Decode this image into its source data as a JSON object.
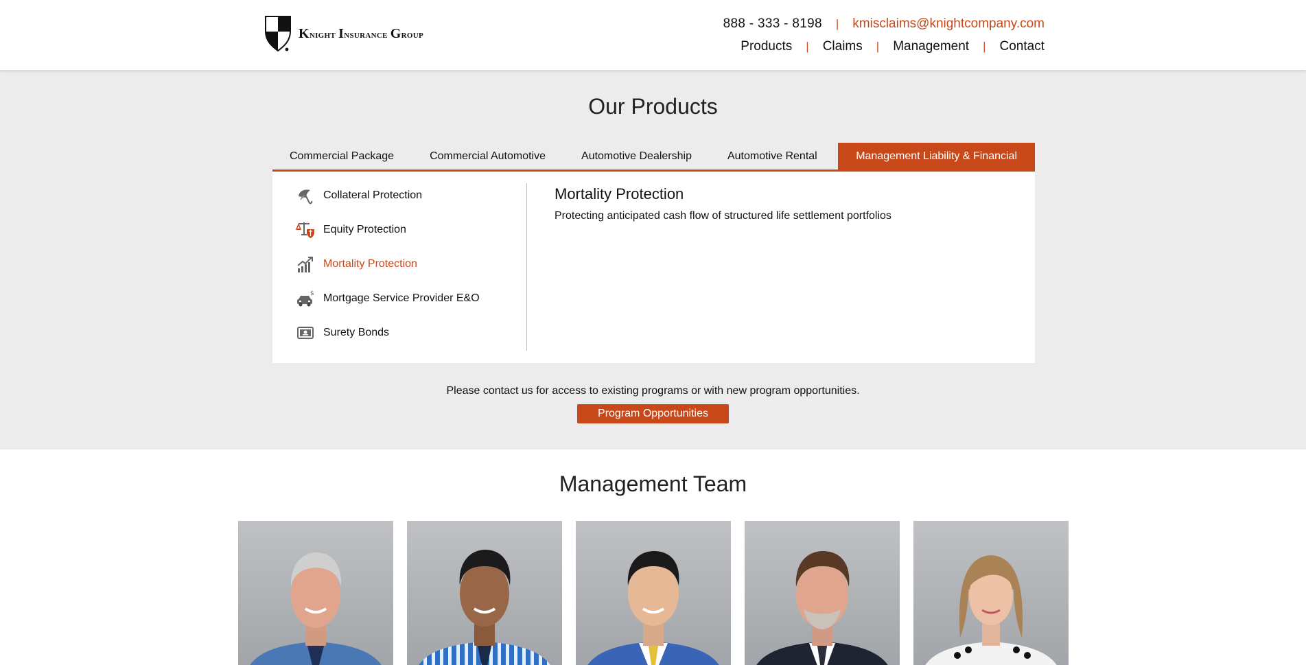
{
  "header": {
    "logo_text_first_cap": "K",
    "logo_text_first_rest": "night",
    "logo_text_second_cap": "I",
    "logo_text_second_rest": "nsurance",
    "logo_text_third_cap": "G",
    "logo_text_third_rest": "roup",
    "phone": "888 - 333 - 8198",
    "separator": "|",
    "email": "kmisclaims@knightcompany.com",
    "nav": [
      "Products",
      "Claims",
      "Management",
      "Contact"
    ]
  },
  "products": {
    "title": "Our Products",
    "tabs": [
      "Commercial Package",
      "Commercial Automotive",
      "Automotive Dealership",
      "Automotive Rental",
      "Management Liability & Financial"
    ],
    "active_tab_index": 4,
    "items": [
      {
        "label": "Collateral Protection",
        "icon": "umbrella-icon"
      },
      {
        "label": "Equity Protection",
        "icon": "scales-shield-icon"
      },
      {
        "label": "Mortality Protection",
        "icon": "growth-chart-icon"
      },
      {
        "label": "Mortgage Service Provider E&O",
        "icon": "car-money-icon"
      },
      {
        "label": "Surety Bonds",
        "icon": "bond-certificate-icon"
      }
    ],
    "active_item_index": 2,
    "detail_title": "Mortality Protection",
    "detail_text": "Protecting anticipated cash flow of structured life settlement portfolios",
    "contact_text": "Please contact us for access to existing programs or with new program opportunities.",
    "program_button": "Program Opportunities"
  },
  "team": {
    "title": "Management Team",
    "members_count": 5
  },
  "colors": {
    "accent": "#c8481a",
    "section_bg": "#ececec"
  }
}
